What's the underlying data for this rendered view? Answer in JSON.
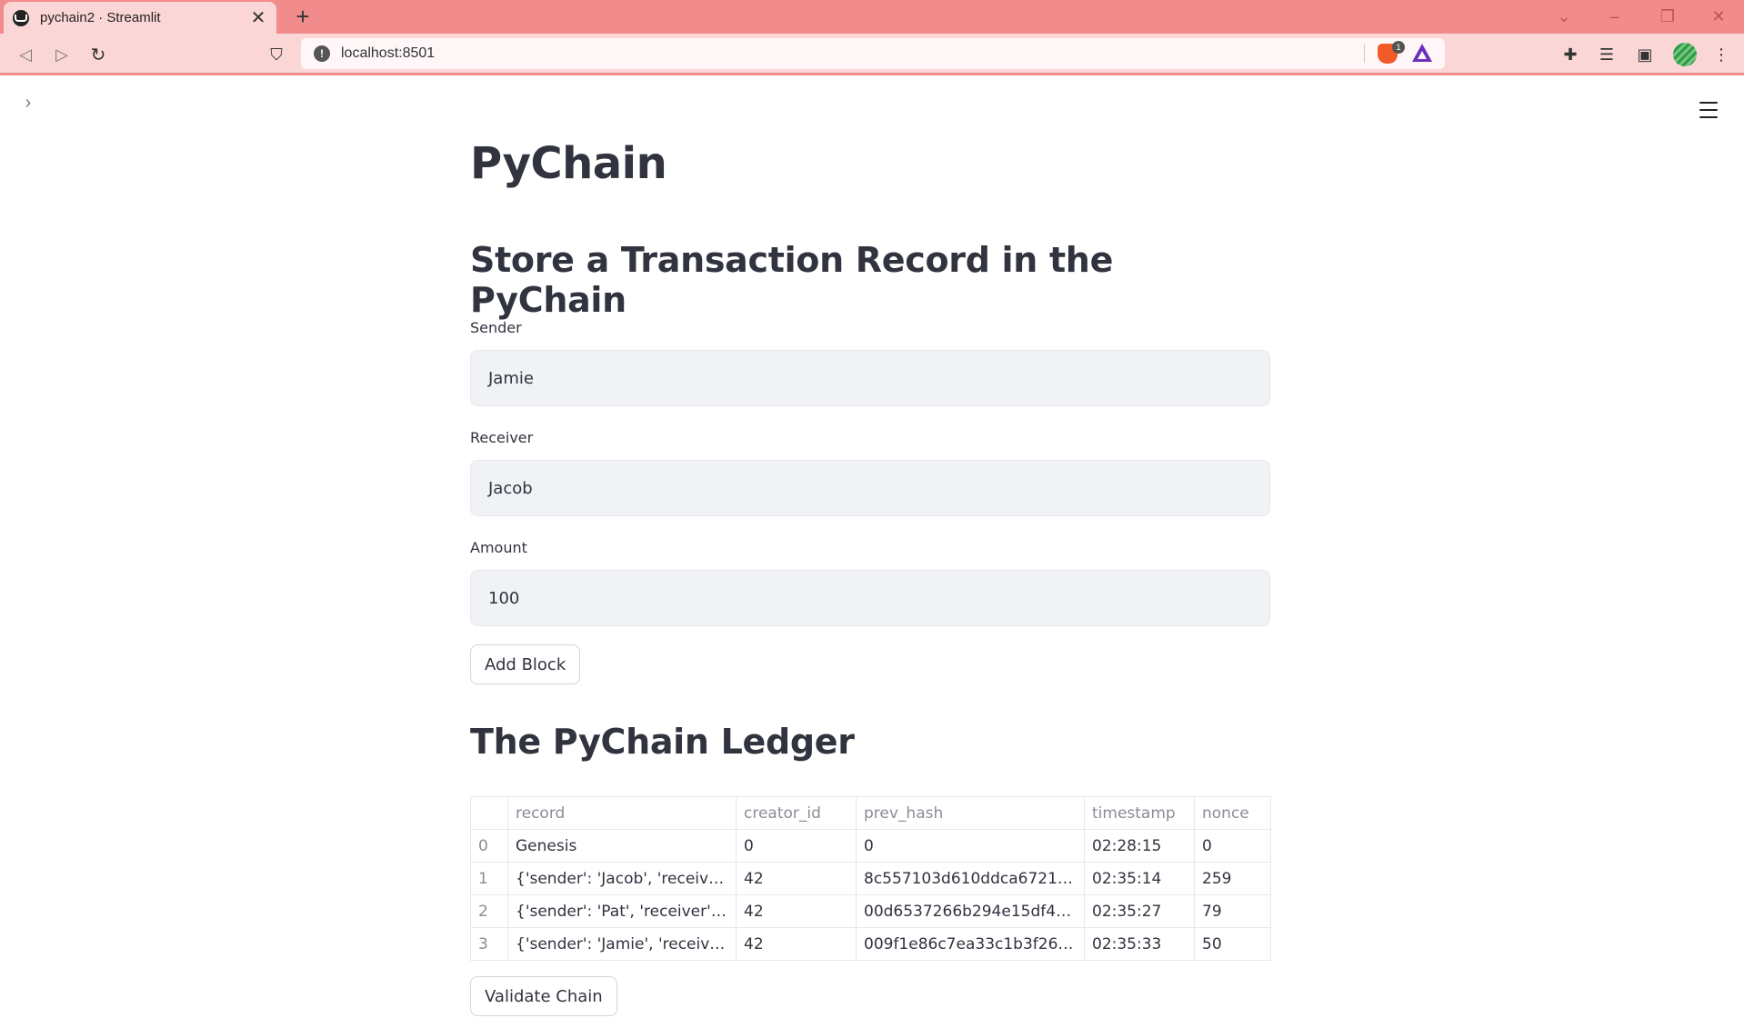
{
  "browser": {
    "tab_title": "pychain2 · Streamlit",
    "tab_close": "✕",
    "new_tab": "+",
    "url": "localhost:8501",
    "brave_badge": "1"
  },
  "page": {
    "title": "PyChain",
    "form_heading": "Store a Transaction Record in the PyChain",
    "sender": {
      "label": "Sender",
      "value": "Jamie"
    },
    "receiver": {
      "label": "Receiver",
      "value": "Jacob"
    },
    "amount": {
      "label": "Amount",
      "value": "100"
    },
    "add_block_label": "Add Block",
    "ledger_heading": "The PyChain Ledger",
    "validate_label": "Validate Chain"
  },
  "ledger": {
    "columns": [
      "",
      "record",
      "creator_id",
      "prev_hash",
      "timestamp",
      "nonce"
    ],
    "rows": [
      [
        "0",
        "Genesis",
        "0",
        "0",
        "02:28:15",
        "0"
      ],
      [
        "1",
        "{'sender': 'Jacob', 'receive…",
        "42",
        "8c557103d610ddca67213…",
        "02:35:14",
        "259"
      ],
      [
        "2",
        "{'sender': 'Pat', 'receiver': '…",
        "42",
        "00d6537266b294e15df45…",
        "02:35:27",
        "79"
      ],
      [
        "3",
        "{'sender': 'Jamie', 'receive…",
        "42",
        "009f1e86c7ea33c1b3f260…",
        "02:35:33",
        "50"
      ]
    ]
  }
}
